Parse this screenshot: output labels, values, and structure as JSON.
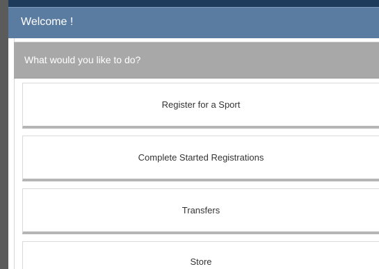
{
  "header": {
    "title": "Welcome !"
  },
  "prompt": {
    "question": "What would you like to do?"
  },
  "actions": [
    {
      "label": "Register for a Sport"
    },
    {
      "label": "Complete Started Registrations"
    },
    {
      "label": "Transfers"
    },
    {
      "label": "Store"
    }
  ],
  "colors": {
    "header_bar": "#5b7ca1",
    "top_strip": "#1e3b5c",
    "question_bar": "#a8a8a8",
    "left_rail": "#5b5b5b",
    "button_bg": "#ffffff"
  }
}
